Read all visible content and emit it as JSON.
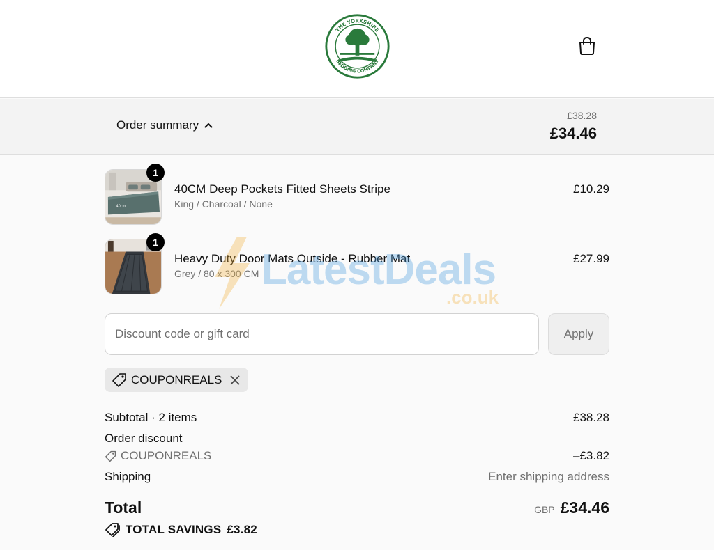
{
  "brand": {
    "name": "The Yorkshire Bedding Company",
    "logo_top_text": "THE YORKSHIRE",
    "logo_bottom_text": "BEDDING COMPANY",
    "green": "#2a7a3b"
  },
  "header": {
    "cart_icon": "shopping-bag-icon"
  },
  "summary": {
    "toggle_label": "Order summary",
    "original_price": "£38.28",
    "total_price": "£34.46"
  },
  "items": [
    {
      "quantity": "1",
      "title": "40CM Deep Pockets Fitted Sheets Stripe",
      "variant": "King / Charcoal / None",
      "price": "£10.29"
    },
    {
      "quantity": "1",
      "title": "Heavy Duty Door Mats Outside - Rubber Mat",
      "variant": "Grey / 80 x 300 CM",
      "price": "£27.99"
    }
  ],
  "discount": {
    "placeholder": "Discount code or gift card",
    "apply_label": "Apply",
    "applied_code": "COUPONREALS"
  },
  "totals": {
    "subtotal_label": "Subtotal · 2 items",
    "subtotal_value": "£38.28",
    "order_discount_label": "Order discount",
    "discount_code": "COUPONREALS",
    "discount_value": "–£3.82",
    "shipping_label": "Shipping",
    "shipping_value": "Enter shipping address",
    "total_label": "Total",
    "currency": "GBP",
    "total_value": "£34.46",
    "savings_label": "TOTAL SAVINGS",
    "savings_value": "£3.82"
  },
  "watermark": {
    "text": "LatestDeals",
    "sub": ".co.uk"
  }
}
